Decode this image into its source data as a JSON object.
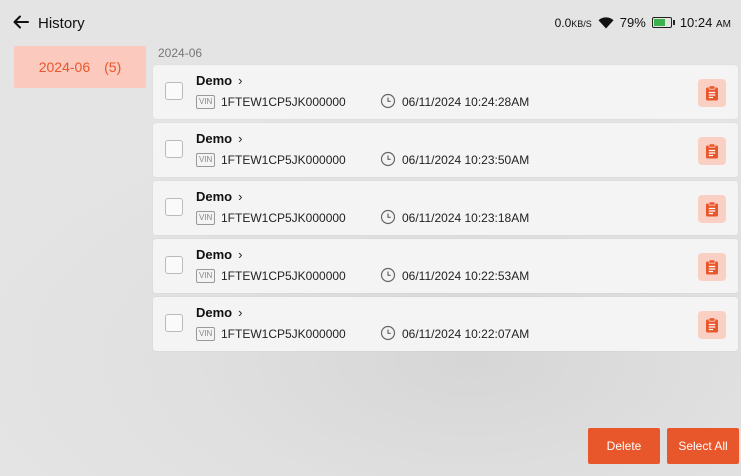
{
  "header": {
    "title": "History",
    "back_icon": "arrow-left-icon"
  },
  "status_bar": {
    "speed_value": "0.0",
    "speed_unit": "KB/S",
    "battery_percent": "79%",
    "battery_level": 0.79,
    "time": "10:24",
    "time_suffix": "AM",
    "battery_color": "#3bb34a"
  },
  "sidebar": {
    "tabs": [
      {
        "label": "2024-06",
        "count": "(5)",
        "selected": true
      }
    ]
  },
  "group": {
    "label": "2024-06"
  },
  "records": [
    {
      "name": "Demo",
      "vin_badge": "VIN",
      "vin": "1FTEW1CP5JK000000",
      "datetime": "06/11/2024 10:24:28AM"
    },
    {
      "name": "Demo",
      "vin_badge": "VIN",
      "vin": "1FTEW1CP5JK000000",
      "datetime": "06/11/2024 10:23:50AM"
    },
    {
      "name": "Demo",
      "vin_badge": "VIN",
      "vin": "1FTEW1CP5JK000000",
      "datetime": "06/11/2024 10:23:18AM"
    },
    {
      "name": "Demo",
      "vin_badge": "VIN",
      "vin": "1FTEW1CP5JK000000",
      "datetime": "06/11/2024 10:22:53AM"
    },
    {
      "name": "Demo",
      "vin_badge": "VIN",
      "vin": "1FTEW1CP5JK000000",
      "datetime": "06/11/2024 10:22:07AM"
    }
  ],
  "actions": {
    "delete_label": "Delete",
    "select_all_label": "Select All"
  },
  "colors": {
    "accent": "#e8572b",
    "accent_light": "#fbc9bd"
  }
}
